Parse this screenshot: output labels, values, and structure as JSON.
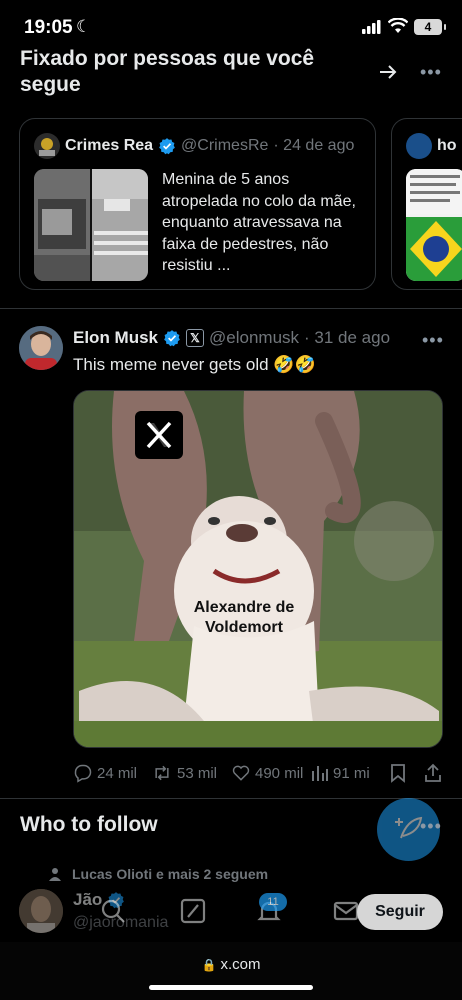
{
  "status_bar": {
    "time": "19:05",
    "battery": "4"
  },
  "pinned": {
    "title": "Fixado por pessoas que você segue",
    "cards": [
      {
        "name": "Crimes Rea",
        "handle": "@CrimesRe",
        "date": "· 24 de ago",
        "text": "Menina de 5 anos atropelada no colo da mãe, enquanto atravessava na faixa de pedestres, não resistiu ..."
      },
      {
        "name": "ho"
      }
    ]
  },
  "tweet": {
    "author": "Elon Musk",
    "affiliate_badge": "𝕏",
    "handle": "@elonmusk",
    "date": "· 31 de ago",
    "text": "This meme never gets old 🤣🤣",
    "media_caption": "Alexandre de Voldemort",
    "stats": {
      "replies": "24 mil",
      "reposts": "53 mil",
      "likes": "490 mil",
      "views": "91 mi"
    }
  },
  "who_to_follow": {
    "title": "Who to follow",
    "social_context": "Lucas Olioti e mais 2 seguem",
    "user": {
      "name": "Jão",
      "handle": "@jaoromania"
    },
    "follow_label": "Seguir"
  },
  "nav": {
    "notifications_count": "11"
  },
  "browser": {
    "url": "x.com"
  },
  "colors": {
    "accent": "#1d9bf0",
    "background": "#000000",
    "secondary_text": "#71767b"
  }
}
